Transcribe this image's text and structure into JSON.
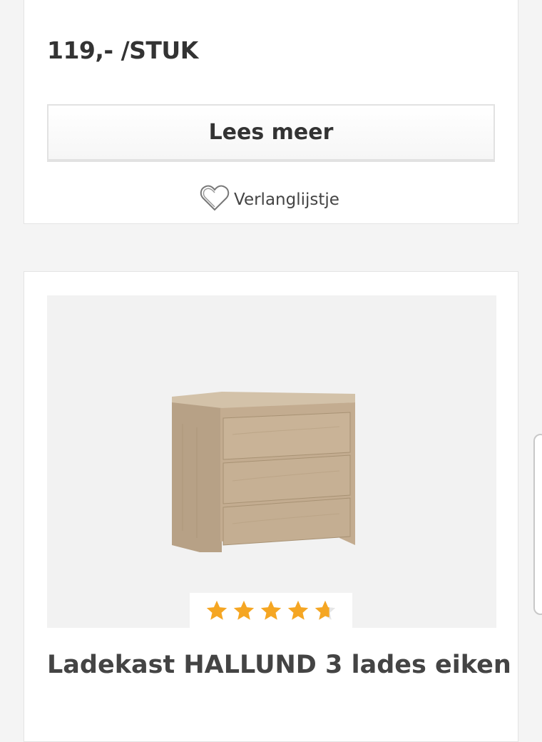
{
  "top_card": {
    "price": "119,- /STUK",
    "read_more_label": "Lees meer",
    "wishlist_label": "Verlanglijstje"
  },
  "product": {
    "title": "Ladekast HALLUND 3 lades eiken",
    "rating": 4.5,
    "rating_max": 5,
    "colors": {
      "star": "#f5a623",
      "wood": "#c7b299"
    }
  }
}
